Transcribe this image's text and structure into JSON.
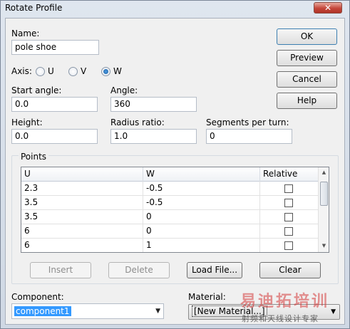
{
  "window": {
    "title": "Rotate Profile",
    "close_glyph": "✕"
  },
  "name_field": {
    "label": "Name:",
    "value": "pole shoe"
  },
  "axis": {
    "label": "Axis:",
    "options": [
      {
        "label": "U",
        "checked": false
      },
      {
        "label": "V",
        "checked": false
      },
      {
        "label": "W",
        "checked": true
      }
    ]
  },
  "start_angle": {
    "label": "Start angle:",
    "value": "0.0"
  },
  "angle": {
    "label": "Angle:",
    "value": "360"
  },
  "height": {
    "label": "Height:",
    "value": "0.0"
  },
  "radius_ratio": {
    "label": "Radius ratio:",
    "value": "1.0"
  },
  "segments": {
    "label": "Segments per turn:",
    "value": "0"
  },
  "side_buttons": {
    "ok": "OK",
    "preview": "Preview",
    "cancel": "Cancel",
    "help": "Help"
  },
  "points": {
    "group_label": "Points",
    "columns": [
      "U",
      "W",
      "Relative"
    ],
    "rows": [
      {
        "u": "2.3",
        "w": "-0.5",
        "relative": false
      },
      {
        "u": "3.5",
        "w": "-0.5",
        "relative": false
      },
      {
        "u": "3.5",
        "w": "0",
        "relative": false
      },
      {
        "u": "6",
        "w": "0",
        "relative": false
      },
      {
        "u": "6",
        "w": "1",
        "relative": false
      }
    ],
    "buttons": {
      "insert": "Insert",
      "delete": "Delete",
      "load_file": "Load File...",
      "clear": "Clear"
    }
  },
  "component": {
    "label": "Component:",
    "value": "component1"
  },
  "material": {
    "label": "Material:",
    "value": "[New Material...]"
  },
  "watermark": {
    "line1": "易迪拓培训",
    "line2": "射频和天线设计专家"
  },
  "colors": {
    "accent": "#3399ff",
    "window_bg": "#f0f0f0",
    "close": "#c4463a"
  }
}
